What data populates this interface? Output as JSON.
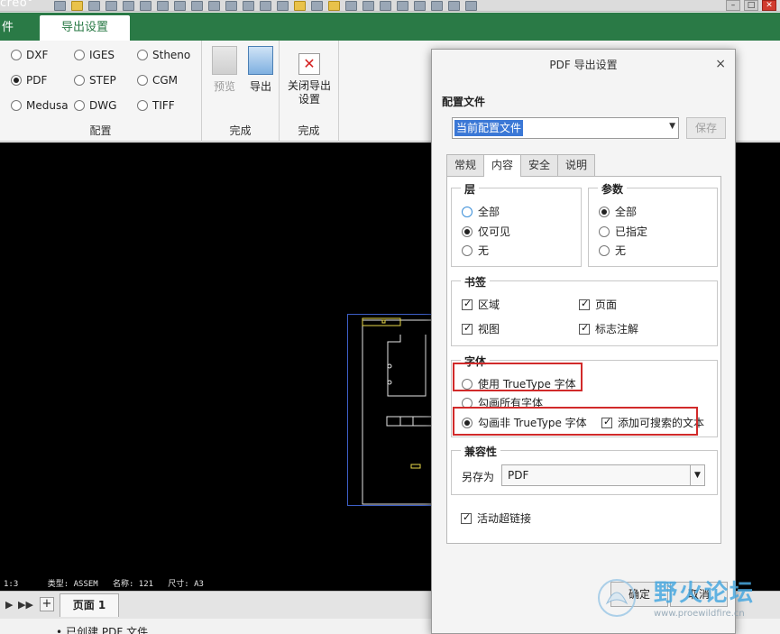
{
  "app": {
    "title": "creo°"
  },
  "ribbon": {
    "tabs": [
      {
        "label": "件"
      },
      {
        "label": "导出设置"
      }
    ],
    "formats": [
      {
        "label": "DXF",
        "selected": false
      },
      {
        "label": "IGES",
        "selected": false
      },
      {
        "label": "Stheno",
        "selected": false
      },
      {
        "label": "PDF",
        "selected": true
      },
      {
        "label": "STEP",
        "selected": false
      },
      {
        "label": "CGM",
        "selected": false
      },
      {
        "label": "Medusa",
        "selected": false
      },
      {
        "label": "DWG",
        "selected": false
      },
      {
        "label": "TIFF",
        "selected": false
      }
    ],
    "group_config": "配置",
    "preview_label": "预览",
    "export_label": "导出",
    "close_label_1": "关闭导出",
    "close_label_2": "设置",
    "group_finish_1": "完成",
    "group_finish_2": "完成",
    "close_glyph": "✕"
  },
  "canvas": {
    "status_text": "1:3      类型: ASSEM   名称: 121   尺寸: A3"
  },
  "pagebar": {
    "page_tab": "页面 1",
    "add": "+",
    "nav_prev": "▶",
    "nav_next": "▶▶"
  },
  "message": "已创建 PDF 文件",
  "dialog": {
    "title": "PDF 导出设置",
    "close": "×",
    "config_label": "配置文件",
    "config_value": "当前配置文件",
    "save_button": "保存",
    "tabs": [
      {
        "label": "常规",
        "active": false
      },
      {
        "label": "内容",
        "active": true
      },
      {
        "label": "安全",
        "active": false
      },
      {
        "label": "说明",
        "active": false
      }
    ],
    "layers": {
      "title": "层",
      "options": [
        {
          "label": "全部",
          "selected": false
        },
        {
          "label": "仅可见",
          "selected": true
        },
        {
          "label": "无",
          "selected": false
        }
      ]
    },
    "params": {
      "title": "参数",
      "options": [
        {
          "label": "全部",
          "selected": true
        },
        {
          "label": "已指定",
          "selected": false
        },
        {
          "label": "无",
          "selected": false
        }
      ]
    },
    "bookmarks": {
      "title": "书签",
      "items": [
        {
          "label": "区域",
          "checked": true
        },
        {
          "label": "页面",
          "checked": true
        },
        {
          "label": "视图",
          "checked": true
        },
        {
          "label": "标志注解",
          "checked": true
        }
      ]
    },
    "fonts": {
      "title": "字体",
      "options": [
        {
          "label": "使用 TrueType 字体",
          "selected": false
        },
        {
          "label": "勾画所有字体",
          "selected": false
        },
        {
          "label": "勾画非 TrueType 字体",
          "selected": true
        }
      ],
      "searchable_text": {
        "label": "添加可搜索的文本",
        "checked": true
      }
    },
    "compat": {
      "title": "兼容性",
      "saveas_label": "另存为",
      "saveas_value": "PDF"
    },
    "hyperlinks": {
      "label": "活动超链接",
      "checked": true
    },
    "ok_button": "确定",
    "cancel_button": "取消"
  },
  "watermark": {
    "text": "野火论坛",
    "url": "www.proewildfire.cn"
  },
  "colors": {
    "ribbon_green": "#2a7a46",
    "selection_blue": "#3b78d6",
    "highlight_red": "#d12a2a"
  }
}
